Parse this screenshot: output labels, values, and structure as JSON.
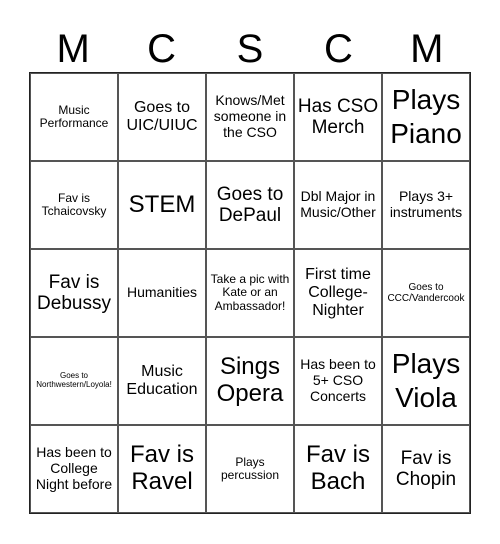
{
  "header": [
    "M",
    "C",
    "S",
    "C",
    "M"
  ],
  "cells": [
    [
      "Music Performance",
      "Goes to UIC/UIUC",
      "Knows/Met someone in the CSO",
      "Has CSO Merch",
      "Plays Piano"
    ],
    [
      "Fav is Tchaicovsky",
      "STEM",
      "Goes to DePaul",
      "Dbl Major in Music/Other",
      "Plays 3+ instruments"
    ],
    [
      "Fav is Debussy",
      "Humanities",
      "Take a pic with Kate or an Ambassador!",
      "First time College-Nighter",
      "Goes to CCC/Vandercook"
    ],
    [
      "Goes to Northwestern/Loyola!",
      "Music Education",
      "Sings Opera",
      "Has been to 5+ CSO Concerts",
      "Plays Viola"
    ],
    [
      "Has been to College Night before",
      "Fav is Ravel",
      "Plays percussion",
      "Fav is Bach",
      "Fav is Chopin"
    ]
  ]
}
